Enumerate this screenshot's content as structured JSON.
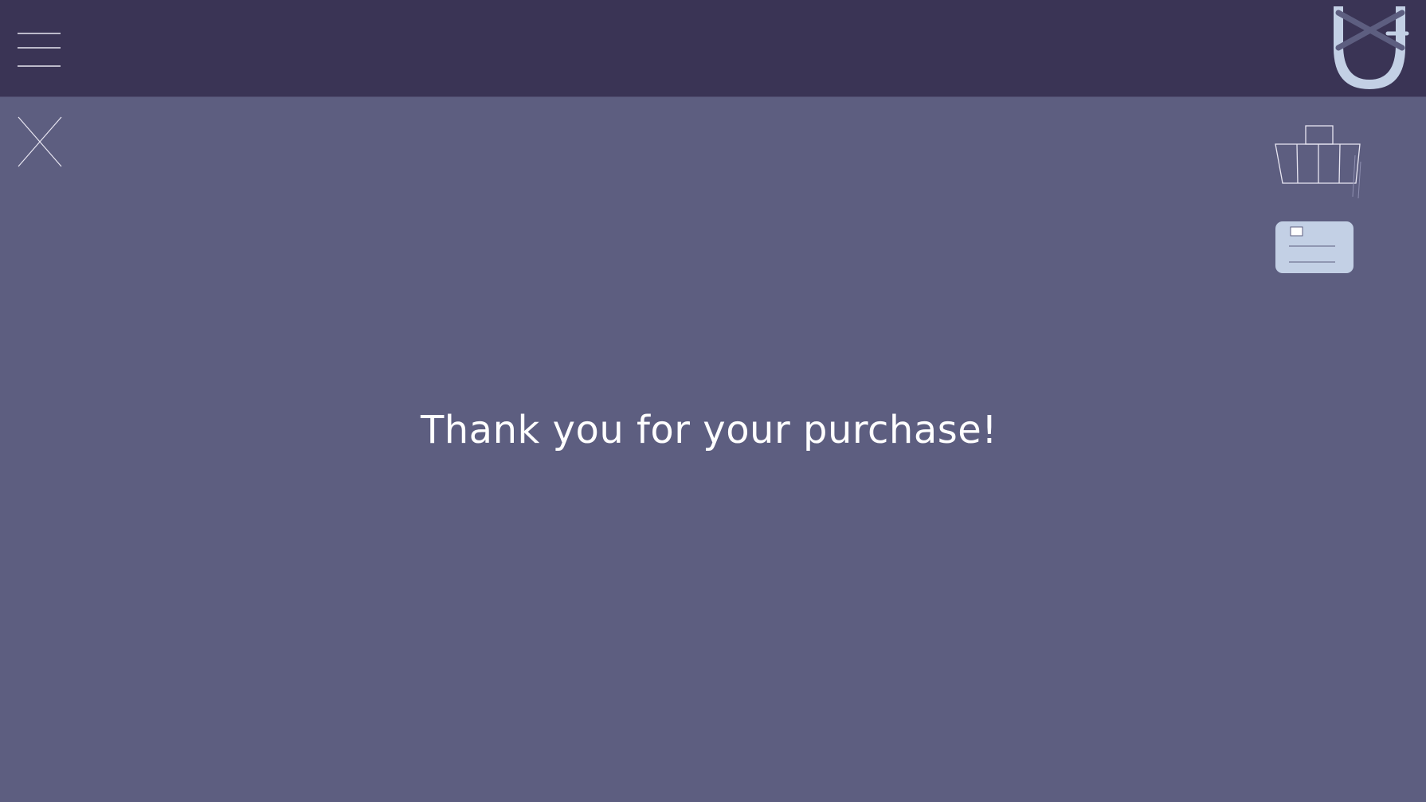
{
  "header": {
    "menu_icon": "hamburger-menu-icon",
    "logo_icon": "horseshoe-logo-icon"
  },
  "actions": {
    "close_icon": "close-icon",
    "basket_icon": "shopping-basket-icon",
    "card_icon": "payment-card-icon"
  },
  "main": {
    "message": "Thank you for your purchase!"
  },
  "colors": {
    "background": "#5d5e80",
    "header": "#3a3455",
    "accent": "#c3d0e5",
    "text": "#ffffff"
  }
}
